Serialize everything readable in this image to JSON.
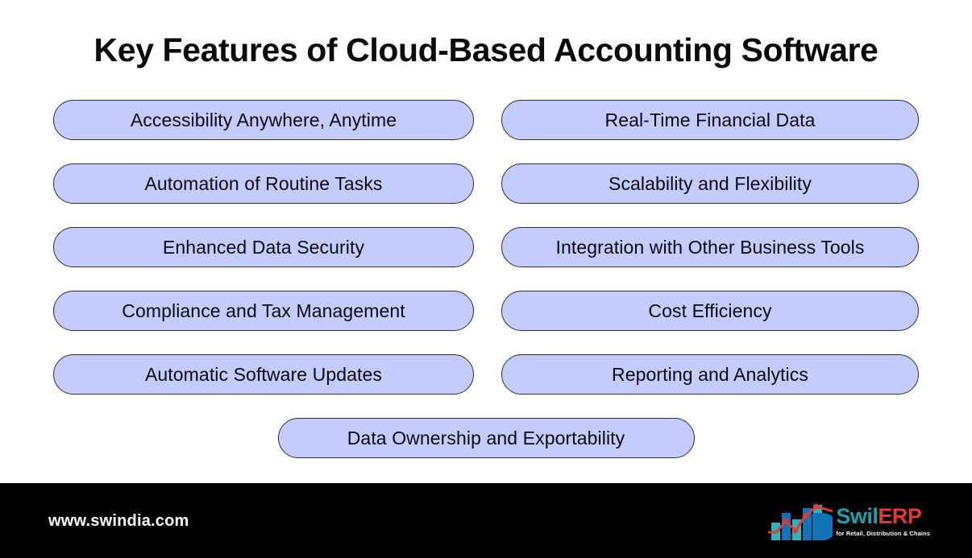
{
  "slide": {
    "title": "Key Features of Cloud-Based Accounting Software",
    "background_color": "#ffffff",
    "pill_fill_color": "#c3ccfd",
    "pill_border_color": "#2e2e38",
    "text_color": "#0b0b0d"
  },
  "features": {
    "rows": [
      {
        "left": "Accessibility Anywhere, Anytime",
        "right": "Real-Time Financial Data"
      },
      {
        "left": "Automation of Routine Tasks",
        "right": "Scalability and Flexibility"
      },
      {
        "left": "Enhanced Data Security",
        "right": "Integration with Other Business Tools"
      },
      {
        "left": "Compliance and Tax Management",
        "right": "Cost Efficiency"
      },
      {
        "left": "Automatic Software Updates",
        "right": "Reporting and Analytics"
      }
    ],
    "final": "Data Ownership and Exportability"
  },
  "footer": {
    "background_color": "#000000",
    "url": "www.swindia.com",
    "logo": {
      "mark_name": "bar-chart-growth-icon",
      "brand_primary": "Swil",
      "brand_secondary": "ERP",
      "tagline": "for Retail, Distribution & Chains",
      "teal": "#17a3ab",
      "blue": "#1273b8",
      "red": "#e03a34"
    }
  }
}
